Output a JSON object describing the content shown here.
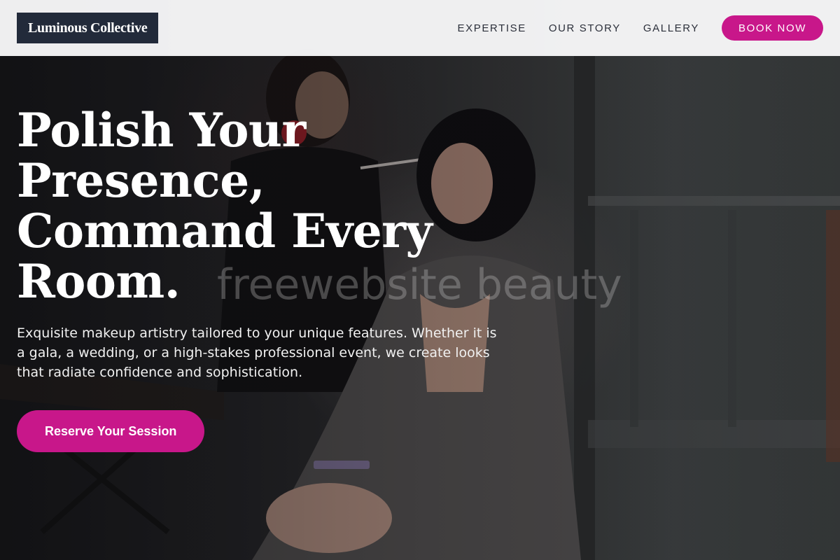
{
  "header": {
    "logo": "Luminous Collective",
    "nav": [
      {
        "label": "EXPERTISE"
      },
      {
        "label": "OUR STORY"
      },
      {
        "label": "GALLERY"
      }
    ],
    "cta_label": "BOOK NOW"
  },
  "hero": {
    "headline_lines": [
      "Polish Your",
      "Presence,",
      "Command Every",
      "Room."
    ],
    "subtext": "Exquisite makeup artistry tailored to your unique features. Whether it is a gala, a wedding, or a high-stakes professional event, we create looks that radiate confidence and sophistication.",
    "cta_label": "Reserve Your Session",
    "watermark": "freewebsite beauty"
  },
  "theme": {
    "accent": "#c8178a",
    "logo_bg": "#222a3a",
    "header_bg": "#f8f8f9"
  }
}
